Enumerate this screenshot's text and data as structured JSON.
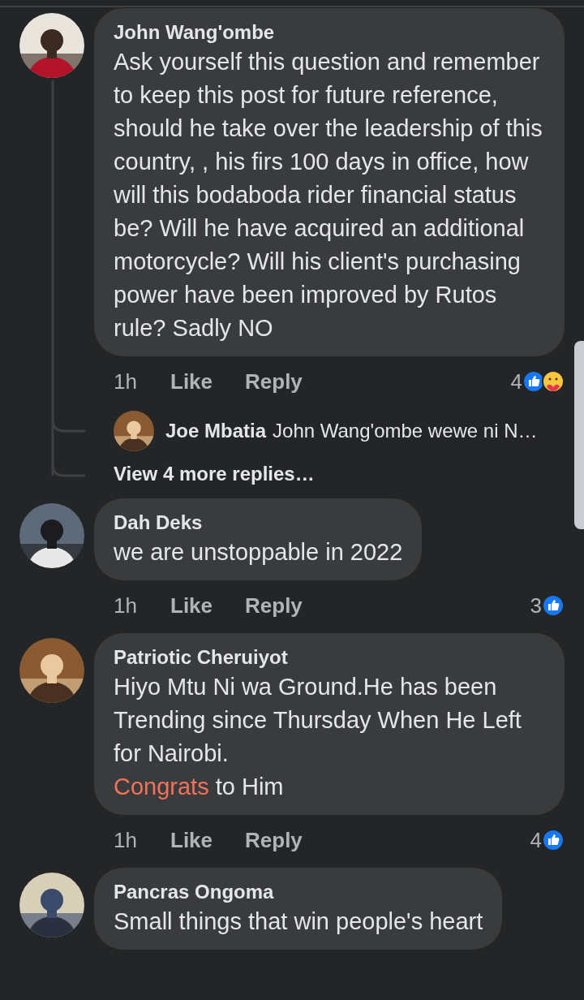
{
  "comments": [
    {
      "author": "John Wang'ombe",
      "segments": [
        {
          "kind": "plain",
          "text": "Ask yourself this question and remember to keep this post for future reference, should he take over the leadership of this country, , his firs 100 days in office, how will this bodaboda rider financial status be? Will he have acquired an additional motorcycle? Will his client's purchasing power have been improved by Rutos rule? Sadly NO"
        }
      ],
      "time": "1h",
      "like": "Like",
      "reply": "Reply",
      "reaction_count": "4",
      "reactions": [
        {
          "kind": "like"
        },
        {
          "kind": "care"
        }
      ],
      "replies": [
        {
          "author": "Joe Mbatia",
          "text": "John Wang'ombe wewe ni N…"
        }
      ],
      "more_replies": "View 4 more replies…"
    },
    {
      "author": "Dah Deks",
      "segments": [
        {
          "kind": "plain",
          "text": "we are unstoppable in 2022"
        }
      ],
      "time": "1h",
      "like": "Like",
      "reply": "Reply",
      "reaction_count": "3",
      "reactions": [
        {
          "kind": "like"
        }
      ]
    },
    {
      "author": "Patriotic Cheruiyot",
      "segments": [
        {
          "kind": "plain",
          "text": "Hiyo Mtu Ni wa Ground.He has been Trending since Thursday When He Left for Nairobi.\n"
        },
        {
          "kind": "tag",
          "text": "Congrats"
        },
        {
          "kind": "plain",
          "text": " to Him"
        }
      ],
      "time": "1h",
      "like": "Like",
      "reply": "Reply",
      "reaction_count": "4",
      "reactions": [
        {
          "kind": "like"
        }
      ]
    },
    {
      "author": "Pancras Ongoma",
      "segments": [
        {
          "kind": "plain",
          "text": "Small things that win people's heart"
        }
      ]
    }
  ]
}
